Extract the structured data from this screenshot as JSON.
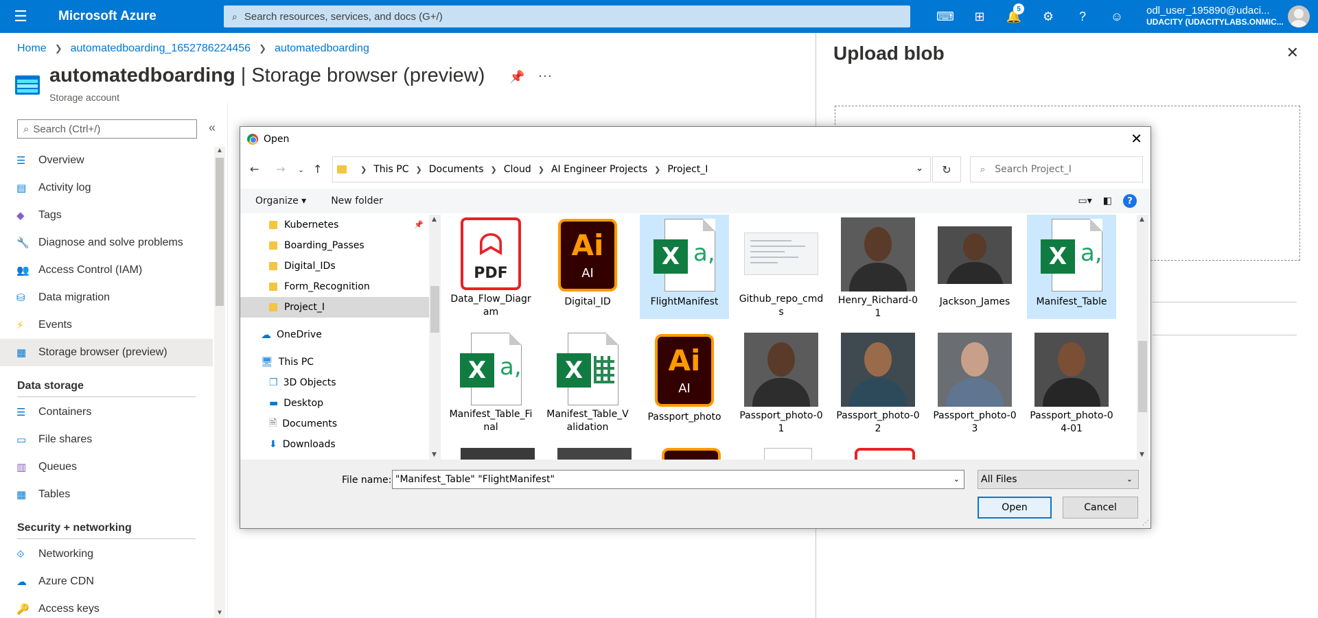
{
  "topbar": {
    "brand": "Microsoft Azure",
    "search_placeholder": "Search resources, services, and docs (G+/)",
    "notifications_count": "5",
    "account_user": "odl_user_195890@udaci...",
    "account_tenant": "UDACITY (UDACITYLABS.ONMIC..."
  },
  "breadcrumb": {
    "items": [
      "Home",
      "automatedboarding_1652786224456",
      "automatedboarding"
    ]
  },
  "resource": {
    "name": "automatedboarding",
    "separator": " | ",
    "section": "Storage browser (preview)",
    "type": "Storage account"
  },
  "nav": {
    "search_placeholder": "Search (Ctrl+/)",
    "items": [
      {
        "label": "Overview"
      },
      {
        "label": "Activity log"
      },
      {
        "label": "Tags"
      },
      {
        "label": "Diagnose and solve problems"
      },
      {
        "label": "Access Control (IAM)"
      },
      {
        "label": "Data migration"
      },
      {
        "label": "Events"
      },
      {
        "label": "Storage browser (preview)"
      }
    ],
    "section_data_storage": "Data storage",
    "data_storage_items": [
      {
        "label": "Containers"
      },
      {
        "label": "File shares"
      },
      {
        "label": "Queues"
      },
      {
        "label": "Tables"
      }
    ],
    "section_security": "Security + networking",
    "security_items": [
      {
        "label": "Networking"
      },
      {
        "label": "Azure CDN"
      },
      {
        "label": "Access keys"
      }
    ]
  },
  "upload_pane": {
    "title": "Upload blob"
  },
  "dialog": {
    "title": "Open",
    "path": [
      "This PC",
      "Documents",
      "Cloud",
      "AI Engineer Projects",
      "Project_I"
    ],
    "search_placeholder": "Search Project_I",
    "organize_label": "Organize ▾",
    "new_folder_label": "New folder",
    "tree": [
      {
        "label": "Kubernetes"
      },
      {
        "label": "Boarding_Passes"
      },
      {
        "label": "Digital_IDs"
      },
      {
        "label": "Form_Recognition"
      },
      {
        "label": "Project_I"
      },
      {
        "label": "OneDrive"
      },
      {
        "label": "This PC"
      },
      {
        "label": "3D Objects"
      },
      {
        "label": "Desktop"
      },
      {
        "label": "Documents"
      },
      {
        "label": "Downloads"
      }
    ],
    "files": [
      {
        "label": "Data_Flow_Diagram",
        "kind": "pdf-icon"
      },
      {
        "label": "Digital_ID",
        "kind": "illustrator-icon"
      },
      {
        "label": "FlightManifest",
        "kind": "excel-csv-icon"
      },
      {
        "label": "Github_repo_cmds",
        "kind": "document-thumbnail"
      },
      {
        "label": "Henry_Richard-01",
        "kind": "photo"
      },
      {
        "label": "Jackson_James",
        "kind": "photo"
      },
      {
        "label": "Manifest_Table",
        "kind": "excel-csv-icon"
      },
      {
        "label": "Manifest_Table_Final",
        "kind": "excel-csv-icon"
      },
      {
        "label": "Manifest_Table_Validation",
        "kind": "excel-icon"
      },
      {
        "label": "Passport_photo",
        "kind": "illustrator-icon"
      },
      {
        "label": "Passport_photo-01",
        "kind": "photo"
      },
      {
        "label": "Passport_photo-02",
        "kind": "photo"
      },
      {
        "label": "Passport_photo-03",
        "kind": "photo"
      },
      {
        "label": "Passport_photo-04-01",
        "kind": "photo"
      }
    ],
    "file_name_label": "File name:",
    "file_name_value": "\"Manifest_Table\" \"FlightManifest\"",
    "file_type_value": "All Files",
    "open_label": "Open",
    "cancel_label": "Cancel"
  },
  "colors": {
    "azure_blue": "#0078d4",
    "selection": "#cce8ff",
    "excel_green": "#107c41",
    "pdf_red": "#e82127",
    "ai_orange": "#ff9a00"
  }
}
